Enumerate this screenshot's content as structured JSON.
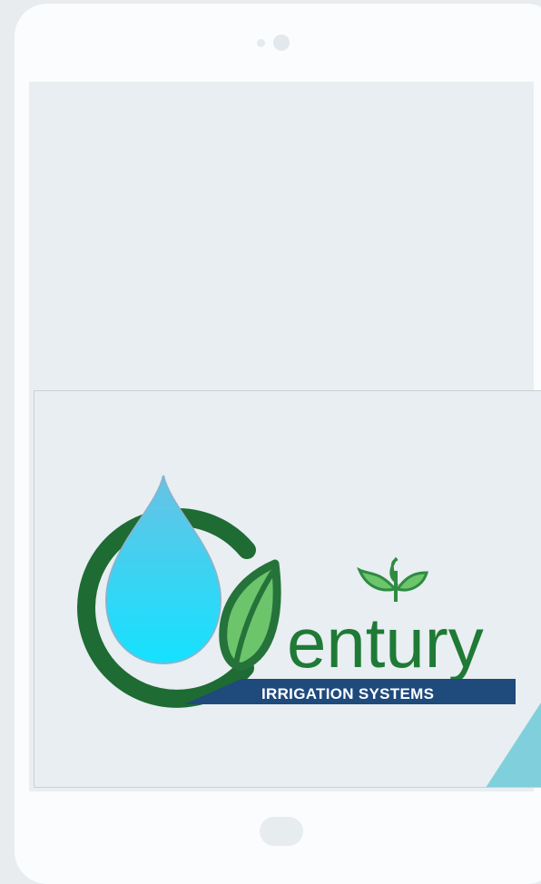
{
  "logo": {
    "brand_word": "entury",
    "tagline": "IRRIGATION SYSTEMS"
  },
  "colors": {
    "ring_green": "#1e6b34",
    "leaf_green": "#6cc56b",
    "leaf_dark": "#25733a",
    "sprout_green": "#2f8a42",
    "banner_blue": "#1e4a7c",
    "drop_top": "#5ec6ea",
    "drop_bottom": "#12e0ff",
    "accent_teal": "#7fd0dc"
  },
  "icons": {
    "droplet": "water-drop-icon",
    "leaf": "leaf-icon",
    "sprout": "sprout-icon"
  }
}
